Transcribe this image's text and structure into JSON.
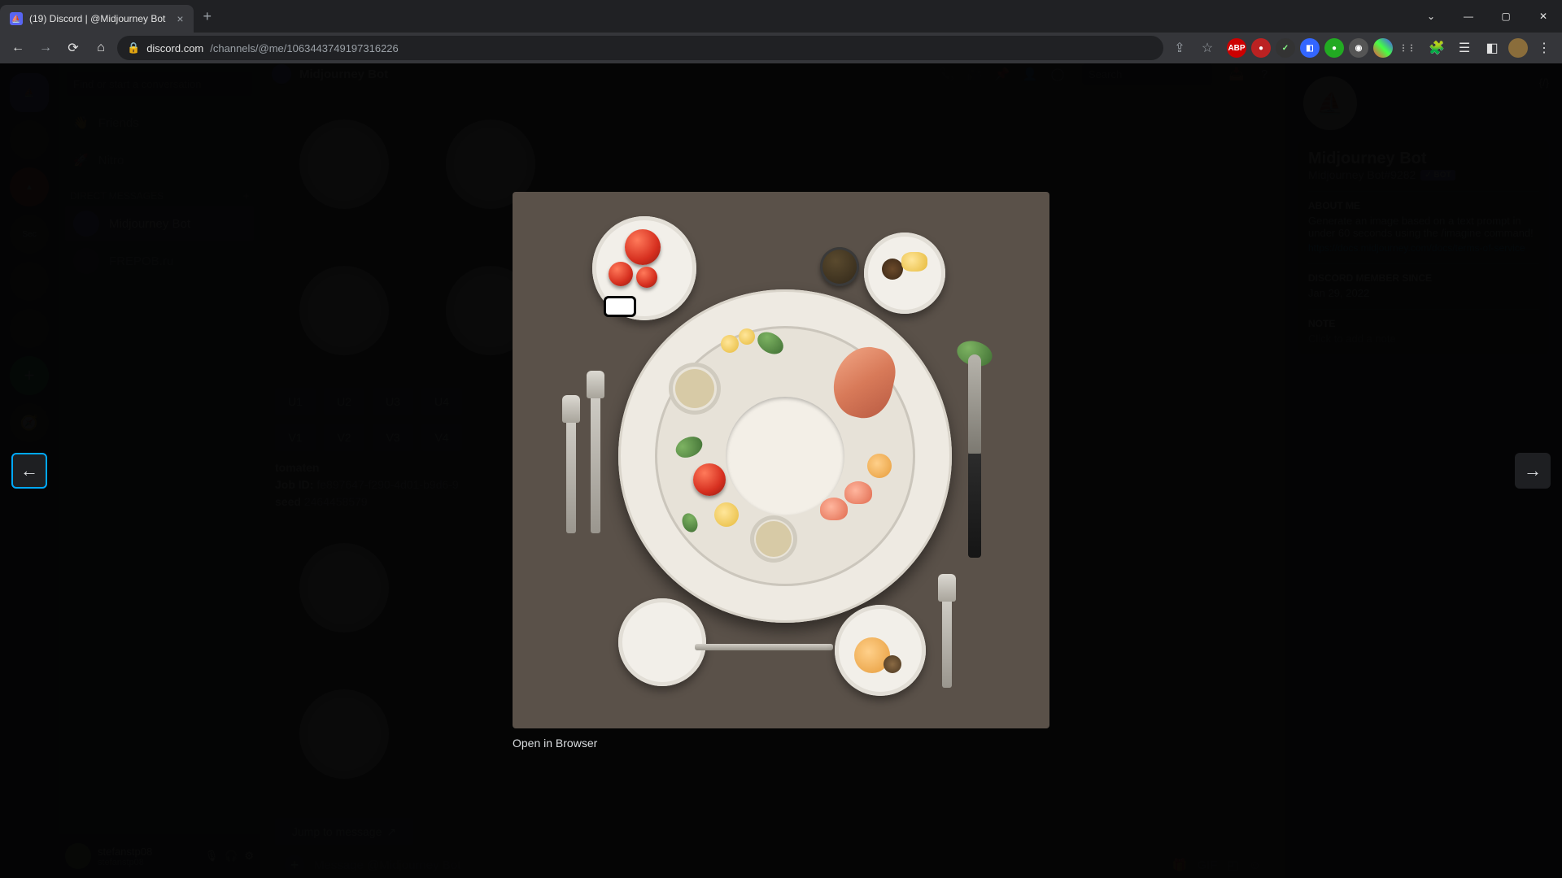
{
  "browser": {
    "tab_title": "(19) Discord | @Midjourney Bot",
    "url_host": "discord.com",
    "url_path": "/channels/@me/1063443749197316226"
  },
  "discord": {
    "search_placeholder": "Find or start a conversation",
    "friends_label": "Friends",
    "nitro_label": "Nitro",
    "dm_header": "Direct Messages",
    "dm_items": [
      "Midjourney Bot",
      "FREPOB.ru"
    ],
    "current_user": "stefanstp08",
    "user_status": "stefanstp08",
    "channel_title": "Midjourney Bot",
    "header_search": "Search",
    "buttons_u": [
      "U1",
      "U2",
      "U3",
      "U4"
    ],
    "buttons_v": [
      "V1",
      "V2",
      "V3",
      "V4"
    ],
    "meta_user": "tomaten",
    "meta_job_label": "Job ID:",
    "meta_job": "fe897647-f290-4d01-b9d6-9",
    "meta_seed_label": "seed",
    "meta_seed": "2464458579",
    "jump_label": "Jump to message",
    "input_placeholder": "Message @Midjourney Bot"
  },
  "profile": {
    "name": "Midjourney Bot",
    "tag": "Midjourney Bot#9282",
    "bot_badge": "✓ BOT",
    "about_hdr": "About Me",
    "about": "Generate an image based on a text prompt in under 60 seconds using the /imagine command!",
    "about_link": "https://docs.midjourney.com/docs/terms-of-service",
    "since_hdr": "Discord Member Since",
    "since": "Jan 29, 2022",
    "note_hdr": "Note",
    "note_placeholder": "Click to add a note"
  },
  "lightbox": {
    "open": "Open in Browser"
  }
}
